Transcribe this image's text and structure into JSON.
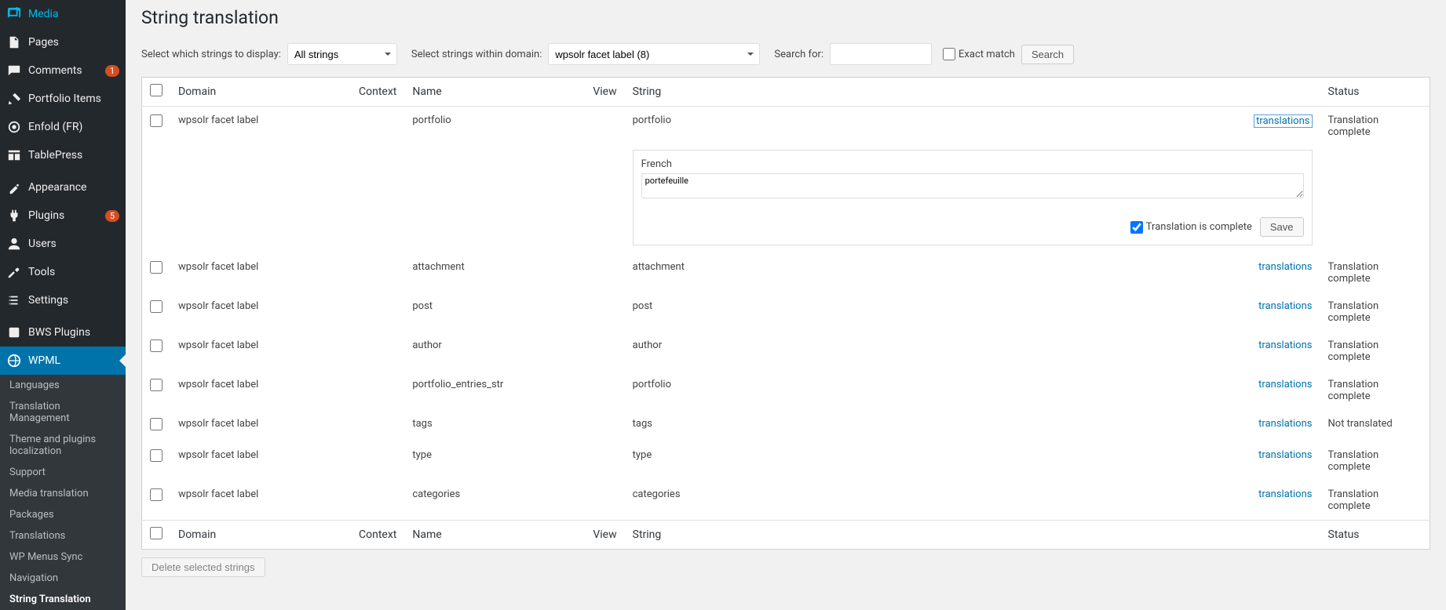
{
  "sidebar": {
    "items": [
      {
        "icon": "media",
        "label": "Media"
      },
      {
        "icon": "pages",
        "label": "Pages"
      },
      {
        "icon": "comments",
        "label": "Comments",
        "badge": "1"
      },
      {
        "icon": "portfolio",
        "label": "Portfolio Items"
      },
      {
        "icon": "enfold",
        "label": "Enfold (FR)"
      },
      {
        "icon": "tablepress",
        "label": "TablePress"
      }
    ],
    "items2": [
      {
        "icon": "appearance",
        "label": "Appearance"
      },
      {
        "icon": "plugins",
        "label": "Plugins",
        "badge": "5"
      },
      {
        "icon": "users",
        "label": "Users"
      },
      {
        "icon": "tools",
        "label": "Tools"
      },
      {
        "icon": "settings",
        "label": "Settings"
      }
    ],
    "items3": [
      {
        "icon": "bws",
        "label": "BWS Plugins"
      },
      {
        "icon": "wpml",
        "label": "WPML",
        "current": true
      }
    ],
    "submenu": [
      "Languages",
      "Translation Management",
      "Theme and plugins localization",
      "Support",
      "Media translation",
      "Packages",
      "Translations",
      "WP Menus Sync",
      "Navigation",
      "String Translation"
    ],
    "submenu_current": "String Translation"
  },
  "page": {
    "title": "String translation"
  },
  "filters": {
    "display_label": "Select which strings to display:",
    "display_value": "All strings",
    "domain_label": "Select strings within domain:",
    "domain_value": "wpsolr facet label (8)",
    "search_label": "Search for:",
    "search_value": "",
    "exact_match_label": "Exact match",
    "search_button": "Search"
  },
  "table": {
    "headers": {
      "domain": "Domain",
      "context": "Context",
      "name": "Name",
      "view": "View",
      "string": "String",
      "status": "Status"
    },
    "rows": [
      {
        "domain": "wpsolr facet label",
        "context": "",
        "name": "portfolio",
        "string": "portfolio",
        "status": "Translation complete",
        "expanded": true,
        "translation": {
          "language": "French",
          "value": "portefeuille",
          "complete": true,
          "save_label": "Save",
          "complete_label": "Translation is complete"
        }
      },
      {
        "domain": "wpsolr facet label",
        "context": "",
        "name": "attachment",
        "string": "attachment",
        "status": "Translation complete"
      },
      {
        "domain": "wpsolr facet label",
        "context": "",
        "name": "post",
        "string": "post",
        "status": "Translation complete"
      },
      {
        "domain": "wpsolr facet label",
        "context": "",
        "name": "author",
        "string": "author",
        "status": "Translation complete"
      },
      {
        "domain": "wpsolr facet label",
        "context": "",
        "name": "portfolio_entries_str",
        "string": "portfolio",
        "status": "Translation complete"
      },
      {
        "domain": "wpsolr facet label",
        "context": "",
        "name": "tags",
        "string": "tags",
        "status": "Not translated"
      },
      {
        "domain": "wpsolr facet label",
        "context": "",
        "name": "type",
        "string": "type",
        "status": "Translation complete"
      },
      {
        "domain": "wpsolr facet label",
        "context": "",
        "name": "categories",
        "string": "categories",
        "status": "Translation complete"
      }
    ],
    "translations_link": "translations",
    "delete_label": "Delete selected strings"
  }
}
